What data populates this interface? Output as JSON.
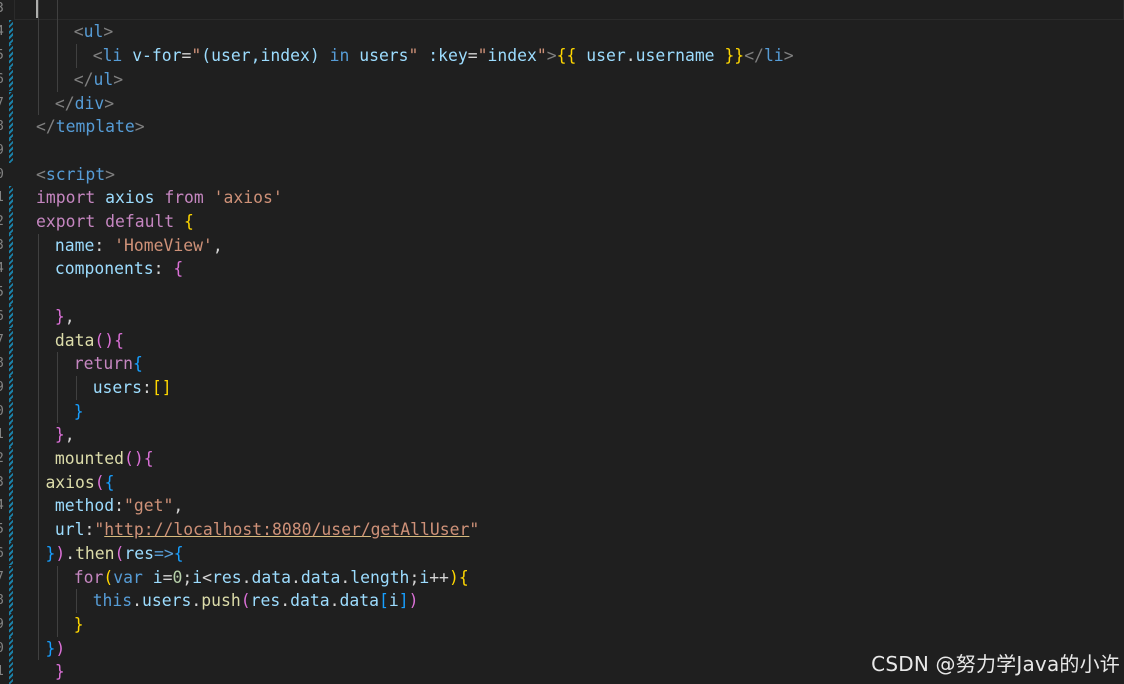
{
  "editor": {
    "line_numbers": [
      "3",
      "4",
      "5",
      "6",
      "7",
      "8",
      "9",
      "0",
      "1",
      "2",
      "3",
      "4",
      "5",
      "6",
      "7",
      "8",
      "9",
      "0",
      "1",
      "2",
      "3",
      "4",
      "5",
      "6",
      "7",
      "8",
      "9",
      "0",
      "1"
    ],
    "lines": [
      [],
      [
        [
          "tag",
          "<"
        ],
        [
          "tagname",
          "ul"
        ],
        [
          "tag",
          ">"
        ]
      ],
      [
        [
          "tag",
          "<"
        ],
        [
          "tagname",
          "li"
        ],
        [
          "plain",
          " "
        ],
        [
          "attr",
          "v-for"
        ],
        [
          "plain",
          "="
        ],
        [
          "str",
          "\""
        ],
        [
          "var",
          "(user,index)"
        ],
        [
          "plain",
          " "
        ],
        [
          "kwb",
          "in"
        ],
        [
          "plain",
          " "
        ],
        [
          "var",
          "users"
        ],
        [
          "str",
          "\""
        ],
        [
          "plain",
          " "
        ],
        [
          "attr",
          ":key"
        ],
        [
          "plain",
          "="
        ],
        [
          "str",
          "\""
        ],
        [
          "var",
          "index"
        ],
        [
          "str",
          "\""
        ],
        [
          "tag",
          ">"
        ],
        [
          "p1",
          "{{"
        ],
        [
          "plain",
          " "
        ],
        [
          "var",
          "user"
        ],
        [
          "plain",
          "."
        ],
        [
          "var",
          "username"
        ],
        [
          "plain",
          " "
        ],
        [
          "p1",
          "}}"
        ],
        [
          "tag",
          "</"
        ],
        [
          "tagname",
          "li"
        ],
        [
          "tag",
          ">"
        ]
      ],
      [
        [
          "tag",
          "</"
        ],
        [
          "tagname",
          "ul"
        ],
        [
          "tag",
          ">"
        ]
      ],
      [
        [
          "tag",
          "</"
        ],
        [
          "tagname",
          "div"
        ],
        [
          "tag",
          ">"
        ]
      ],
      [
        [
          "tag",
          "</"
        ],
        [
          "tagname",
          "template"
        ],
        [
          "tag",
          ">"
        ]
      ],
      [],
      [
        [
          "tag",
          "<"
        ],
        [
          "tagname",
          "script"
        ],
        [
          "tag",
          ">"
        ]
      ],
      [
        [
          "kw",
          "import"
        ],
        [
          "plain",
          " "
        ],
        [
          "var",
          "axios"
        ],
        [
          "plain",
          " "
        ],
        [
          "kw",
          "from"
        ],
        [
          "plain",
          " "
        ],
        [
          "str",
          "'axios'"
        ]
      ],
      [
        [
          "kw",
          "export"
        ],
        [
          "plain",
          " "
        ],
        [
          "kw",
          "default"
        ],
        [
          "plain",
          " "
        ],
        [
          "p1",
          "{"
        ]
      ],
      [
        [
          "var",
          "name"
        ],
        [
          "plain",
          ": "
        ],
        [
          "str",
          "'HomeView'"
        ],
        [
          "plain",
          ","
        ]
      ],
      [
        [
          "var",
          "components"
        ],
        [
          "plain",
          ": "
        ],
        [
          "p2",
          "{"
        ]
      ],
      [],
      [
        [
          "p2",
          "}"
        ],
        [
          "plain",
          ","
        ]
      ],
      [
        [
          "fn",
          "data"
        ],
        [
          "p2",
          "()"
        ],
        [
          "p2",
          "{"
        ]
      ],
      [
        [
          "kw",
          "return"
        ],
        [
          "p3",
          "{"
        ]
      ],
      [
        [
          "var",
          "users"
        ],
        [
          "plain",
          ":"
        ],
        [
          "p1",
          "[]"
        ]
      ],
      [
        [
          "p3",
          "}"
        ]
      ],
      [
        [
          "p2",
          "}"
        ],
        [
          "plain",
          ","
        ]
      ],
      [
        [
          "fn",
          "mounted"
        ],
        [
          "p2",
          "()"
        ],
        [
          "p2",
          "{"
        ]
      ],
      [
        [
          "fn",
          "axios"
        ],
        [
          "p2",
          "("
        ],
        [
          "p3",
          "{"
        ]
      ],
      [
        [
          "var",
          "method"
        ],
        [
          "plain",
          ":"
        ],
        [
          "str",
          "\"get\""
        ],
        [
          "plain",
          ","
        ]
      ],
      [
        [
          "var",
          "url"
        ],
        [
          "plain",
          ":"
        ],
        [
          "str",
          "\""
        ],
        [
          "url",
          "http://localhost:8080/user/getAllUser"
        ],
        [
          "str",
          "\""
        ]
      ],
      [
        [
          "p3",
          "}"
        ],
        [
          "p2",
          ")"
        ],
        [
          "plain",
          "."
        ],
        [
          "fn",
          "then"
        ],
        [
          "p2",
          "("
        ],
        [
          "var",
          "res"
        ],
        [
          "kwb",
          "=>"
        ],
        [
          "p3",
          "{"
        ]
      ],
      [
        [
          "kw",
          "for"
        ],
        [
          "p1",
          "("
        ],
        [
          "kwb",
          "var"
        ],
        [
          "plain",
          " "
        ],
        [
          "var",
          "i"
        ],
        [
          "plain",
          "="
        ],
        [
          "num",
          "0"
        ],
        [
          "plain",
          ";"
        ],
        [
          "var",
          "i"
        ],
        [
          "plain",
          "<"
        ],
        [
          "var",
          "res"
        ],
        [
          "plain",
          "."
        ],
        [
          "var",
          "data"
        ],
        [
          "plain",
          "."
        ],
        [
          "var",
          "data"
        ],
        [
          "plain",
          "."
        ],
        [
          "var",
          "length"
        ],
        [
          "plain",
          ";"
        ],
        [
          "var",
          "i"
        ],
        [
          "plain",
          "++"
        ],
        [
          "p1",
          ")"
        ],
        [
          "p1",
          "{"
        ]
      ],
      [
        [
          "kwb",
          "this"
        ],
        [
          "plain",
          "."
        ],
        [
          "var",
          "users"
        ],
        [
          "plain",
          "."
        ],
        [
          "fn",
          "push"
        ],
        [
          "p2",
          "("
        ],
        [
          "var",
          "res"
        ],
        [
          "plain",
          "."
        ],
        [
          "var",
          "data"
        ],
        [
          "plain",
          "."
        ],
        [
          "var",
          "data"
        ],
        [
          "p3",
          "["
        ],
        [
          "var",
          "i"
        ],
        [
          "p3",
          "]"
        ],
        [
          "p2",
          ")"
        ]
      ],
      [
        [
          "p1",
          "}"
        ]
      ],
      [
        [
          "p3",
          "}"
        ],
        [
          "p2",
          ")"
        ]
      ],
      [
        [
          "p2",
          "}"
        ]
      ]
    ]
  },
  "watermark": "CSDN @努力学Java的小许"
}
